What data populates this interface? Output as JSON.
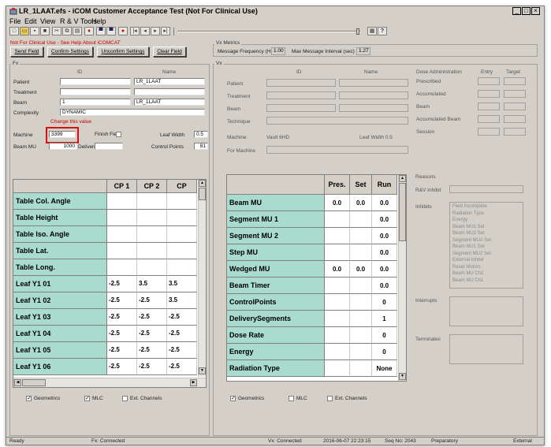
{
  "window": {
    "title": "LR_1LAAT.efs - iCOM Customer Acceptance Test (Not For Clinical Use)",
    "controls": [
      "_",
      "□",
      "×"
    ]
  },
  "menu": [
    "File",
    "Edit",
    "View",
    "R & V Tools",
    "Help"
  ],
  "fx": {
    "warning": "Not For Clinical Use - See Help About iCOMCAT",
    "group_label": "Fx",
    "buttons": {
      "send": "Send Field",
      "confirm": "Confirm Settings",
      "unconfirm": "Unconfirm Settings",
      "clear": "Clear Field"
    },
    "col_id": "ID",
    "col_name": "Name",
    "rows": [
      {
        "label": "Patient",
        "id": "",
        "name": "LR_1LAAT"
      },
      {
        "label": "Treatment",
        "id": "",
        "name": ""
      },
      {
        "label": "Beam",
        "id": "1",
        "name": "LR_1LAAT"
      }
    ],
    "complexity_label": "Complexity",
    "complexity_value": "DYNAMIC",
    "change_note": "Change this value",
    "machine_label": "Machine",
    "machine_value": "3399",
    "finish_field_label": "Finish Field",
    "leaf_width_label": "Leaf Width",
    "leaf_width_value": "0.5",
    "beam_mu_label": "Beam MU",
    "beam_mu_value": "1000",
    "delivered_label": "Delivered",
    "delivered_value": "",
    "control_points_label": "Control Points",
    "control_points_value": "81",
    "grid": {
      "columns": [
        "CP 1",
        "CP 2",
        "CP"
      ],
      "rows": [
        {
          "label": "Table Col. Angle",
          "values": [
            "",
            "",
            ""
          ]
        },
        {
          "label": "Table Height",
          "values": [
            "",
            "",
            ""
          ]
        },
        {
          "label": "Table Iso. Angle",
          "values": [
            "",
            "",
            ""
          ]
        },
        {
          "label": "Table Lat.",
          "values": [
            "",
            "",
            ""
          ]
        },
        {
          "label": "Table Long.",
          "values": [
            "",
            "",
            ""
          ]
        },
        {
          "label": "Leaf Y1 01",
          "values": [
            "-2.5",
            "3.5",
            "3.5"
          ]
        },
        {
          "label": "Leaf Y1 02",
          "values": [
            "-2.5",
            "-2.5",
            "3.5"
          ]
        },
        {
          "label": "Leaf Y1 03",
          "values": [
            "-2.5",
            "-2.5",
            "-2.5"
          ]
        },
        {
          "label": "Leaf Y1 04",
          "values": [
            "-2.5",
            "-2.5",
            "-2.5"
          ]
        },
        {
          "label": "Leaf Y1 05",
          "values": [
            "-2.5",
            "-2.5",
            "-2.5"
          ]
        },
        {
          "label": "Leaf Y1 06",
          "values": [
            "-2.5",
            "-2.5",
            "-2.5"
          ]
        }
      ]
    },
    "checks": [
      {
        "label": "Geometrics",
        "checked": true
      },
      {
        "label": "MLC",
        "checked": true
      },
      {
        "label": "Ext. Channels",
        "checked": false
      }
    ]
  },
  "vx_metrics": {
    "group_label": "Vx Metrics",
    "freq_label": "Message Frequency (Hz)",
    "freq_value": "1.00",
    "interval_label": "Max Message Interval (sec)",
    "interval_value": "1.27"
  },
  "vx": {
    "group_label": "Vx",
    "col_id": "ID",
    "col_name": "Name",
    "rows": [
      "Patient",
      "Treatment",
      "Beam",
      "Technique"
    ],
    "machine_label": "Machine",
    "machine_value": "Vault 6HD",
    "leaf_width": "Leaf Width 0.5",
    "for_machine_label": "For Machine",
    "dose": {
      "header": "Dose Administration",
      "entry": "Entry",
      "target": "Target",
      "rows": [
        "Prescribed",
        "Accumulated",
        "Beam",
        "Accumulated Beam",
        "Session"
      ]
    },
    "reasons_label": "Reasons",
    "rv_inhibit_label": "R&V Inhibit",
    "inhibits_label": "Inhibits",
    "inhibits": [
      "Field Incomplete",
      "Radiation Type",
      "Energy",
      "Beam MU1 Set",
      "Beam MU2 Set",
      "Segment MU2 Set",
      "Beam MU1 Set",
      "Segment MU2 Set",
      "External Inhibit",
      "Reset Motors",
      "Beam MU Ch2",
      "Beam MU Ch1"
    ],
    "interrupts_label": "Interrupts",
    "terminates_label": "Terminates",
    "grid": {
      "columns": [
        "Pres.",
        "Set",
        "Run"
      ],
      "rows": [
        {
          "label": "Beam MU",
          "values": [
            "0.0",
            "0.0",
            "0.0"
          ]
        },
        {
          "label": "Segment MU 1",
          "values": [
            "",
            "",
            "0.0"
          ]
        },
        {
          "label": "Segment MU 2",
          "values": [
            "",
            "",
            "0.0"
          ]
        },
        {
          "label": "Step MU",
          "values": [
            "",
            "",
            "0.0"
          ]
        },
        {
          "label": "Wedged MU",
          "values": [
            "0.0",
            "0.0",
            "0.0"
          ]
        },
        {
          "label": "Beam Timer",
          "values": [
            "",
            "",
            "0.0"
          ]
        },
        {
          "label": "ControlPoints",
          "values": [
            "",
            "",
            "0"
          ]
        },
        {
          "label": "DeliverySegments",
          "values": [
            "",
            "",
            "1"
          ]
        },
        {
          "label": "Dose Rate",
          "values": [
            "",
            "",
            "0"
          ]
        },
        {
          "label": "Energy",
          "values": [
            "",
            "",
            "0"
          ]
        },
        {
          "label": "Radiation Type",
          "values": [
            "",
            "",
            "None"
          ]
        }
      ]
    },
    "checks": [
      {
        "label": "Geometrics",
        "checked": true
      },
      {
        "label": "MLC",
        "checked": false
      },
      {
        "label": "Ext. Channels",
        "checked": false
      }
    ]
  },
  "status": {
    "ready": "Ready",
    "fx": "Fx: Connected",
    "vx": "Vx: Connected",
    "datetime": "2016-06-07 22:23:15",
    "seq": "Seq No: 2043",
    "state": "Preparatory",
    "mode": "External"
  },
  "colors": {
    "row_label_bg": "#a9dccf",
    "window_bg": "#d4d0c8",
    "warning_red": "#cc0000"
  }
}
